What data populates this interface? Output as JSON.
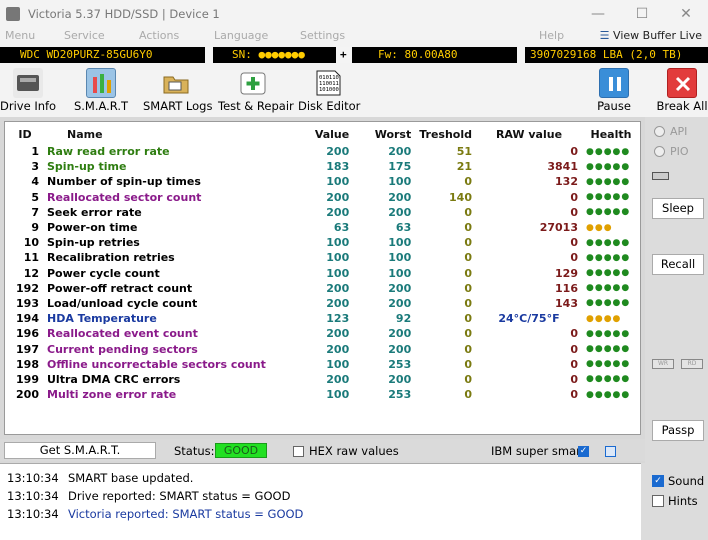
{
  "window": {
    "title": "Victoria 5.37 HDD/SSD | Device 1"
  },
  "menu": {
    "items": [
      "Menu",
      "Service",
      "Actions",
      "Language",
      "Settings",
      "Help"
    ],
    "view_buffer_live": "View Buffer Live"
  },
  "infobar": {
    "model": "WDC WD20PURZ-85GU6Y0",
    "sn": "SN: ●●●●●●●",
    "plus": "+",
    "fw": "Fw: 80.00A80",
    "lba": "3907029168 LBA (2,0 TB)"
  },
  "toolbar": {
    "drive_info": "Drive Info",
    "smart": "S.M.A.R.T",
    "smart_logs": "SMART Logs",
    "test_repair": "Test & Repair",
    "disk_editor": "Disk Editor",
    "pause": "Pause",
    "break_all": "Break All"
  },
  "table": {
    "headers": [
      "ID",
      "Name",
      "Value",
      "Worst",
      "Treshold",
      "RAW value",
      "Health"
    ],
    "rows": [
      {
        "id": "1",
        "name": "Raw read error rate",
        "value": "200",
        "worst": "200",
        "thr": "51",
        "raw": "0",
        "health": "●●●●●"
      },
      {
        "id": "3",
        "name": "Spin-up time",
        "value": "183",
        "worst": "175",
        "thr": "21",
        "raw": "3841",
        "health": "●●●●●"
      },
      {
        "id": "4",
        "name": "Number of spin-up times",
        "value": "100",
        "worst": "100",
        "thr": "0",
        "raw": "132",
        "health": "●●●●●"
      },
      {
        "id": "5",
        "name": "Reallocated sector count",
        "value": "200",
        "worst": "200",
        "thr": "140",
        "raw": "0",
        "health": "●●●●●"
      },
      {
        "id": "7",
        "name": "Seek error rate",
        "value": "200",
        "worst": "200",
        "thr": "0",
        "raw": "0",
        "health": "●●●●●"
      },
      {
        "id": "9",
        "name": "Power-on time",
        "value": "63",
        "worst": "63",
        "thr": "0",
        "raw": "27013",
        "health": "●●●"
      },
      {
        "id": "10",
        "name": "Spin-up retries",
        "value": "100",
        "worst": "100",
        "thr": "0",
        "raw": "0",
        "health": "●●●●●"
      },
      {
        "id": "11",
        "name": "Recalibration retries",
        "value": "100",
        "worst": "100",
        "thr": "0",
        "raw": "0",
        "health": "●●●●●"
      },
      {
        "id": "12",
        "name": "Power cycle count",
        "value": "100",
        "worst": "100",
        "thr": "0",
        "raw": "129",
        "health": "●●●●●"
      },
      {
        "id": "192",
        "name": "Power-off retract count",
        "value": "200",
        "worst": "200",
        "thr": "0",
        "raw": "116",
        "health": "●●●●●"
      },
      {
        "id": "193",
        "name": "Load/unload cycle count",
        "value": "200",
        "worst": "200",
        "thr": "0",
        "raw": "143",
        "health": "●●●●●"
      },
      {
        "id": "194",
        "name": "HDA Temperature",
        "value": "123",
        "worst": "92",
        "thr": "0",
        "raw": "24°C/75°F",
        "health": "●●●●"
      },
      {
        "id": "196",
        "name": "Reallocated event count",
        "value": "200",
        "worst": "200",
        "thr": "0",
        "raw": "0",
        "health": "●●●●●"
      },
      {
        "id": "197",
        "name": "Current pending sectors",
        "value": "200",
        "worst": "200",
        "thr": "0",
        "raw": "0",
        "health": "●●●●●"
      },
      {
        "id": "198",
        "name": "Offline uncorrectable sectors count",
        "value": "100",
        "worst": "253",
        "thr": "0",
        "raw": "0",
        "health": "●●●●●"
      },
      {
        "id": "199",
        "name": "Ultra DMA CRC errors",
        "value": "200",
        "worst": "200",
        "thr": "0",
        "raw": "0",
        "health": "●●●●●"
      },
      {
        "id": "200",
        "name": "Multi zone error rate",
        "value": "100",
        "worst": "253",
        "thr": "0",
        "raw": "0",
        "health": "●●●●●"
      }
    ]
  },
  "bottombar": {
    "get_smart": "Get S.M.A.R.T.",
    "status_label": "Status:",
    "status_value": "GOOD",
    "hex_raw": "HEX raw values",
    "ibm_super_smart": "IBM super smart:"
  },
  "log": [
    {
      "time": "13:10:34",
      "msg": "SMART base updated."
    },
    {
      "time": "13:10:34",
      "msg": "Drive reported: SMART status = GOOD"
    },
    {
      "time": "13:10:34",
      "msg": "Victoria reported: SMART status = GOOD"
    }
  ],
  "rightpanel": {
    "api": "API",
    "pio": "PIO",
    "sleep": "Sleep",
    "recall": "Recall",
    "passp": "Passp",
    "wr": "WR",
    "rd": "RD",
    "sound": "Sound",
    "hints": "Hints"
  },
  "colors": {
    "status_good": "#22e022",
    "accent": "#1a6ad0"
  }
}
